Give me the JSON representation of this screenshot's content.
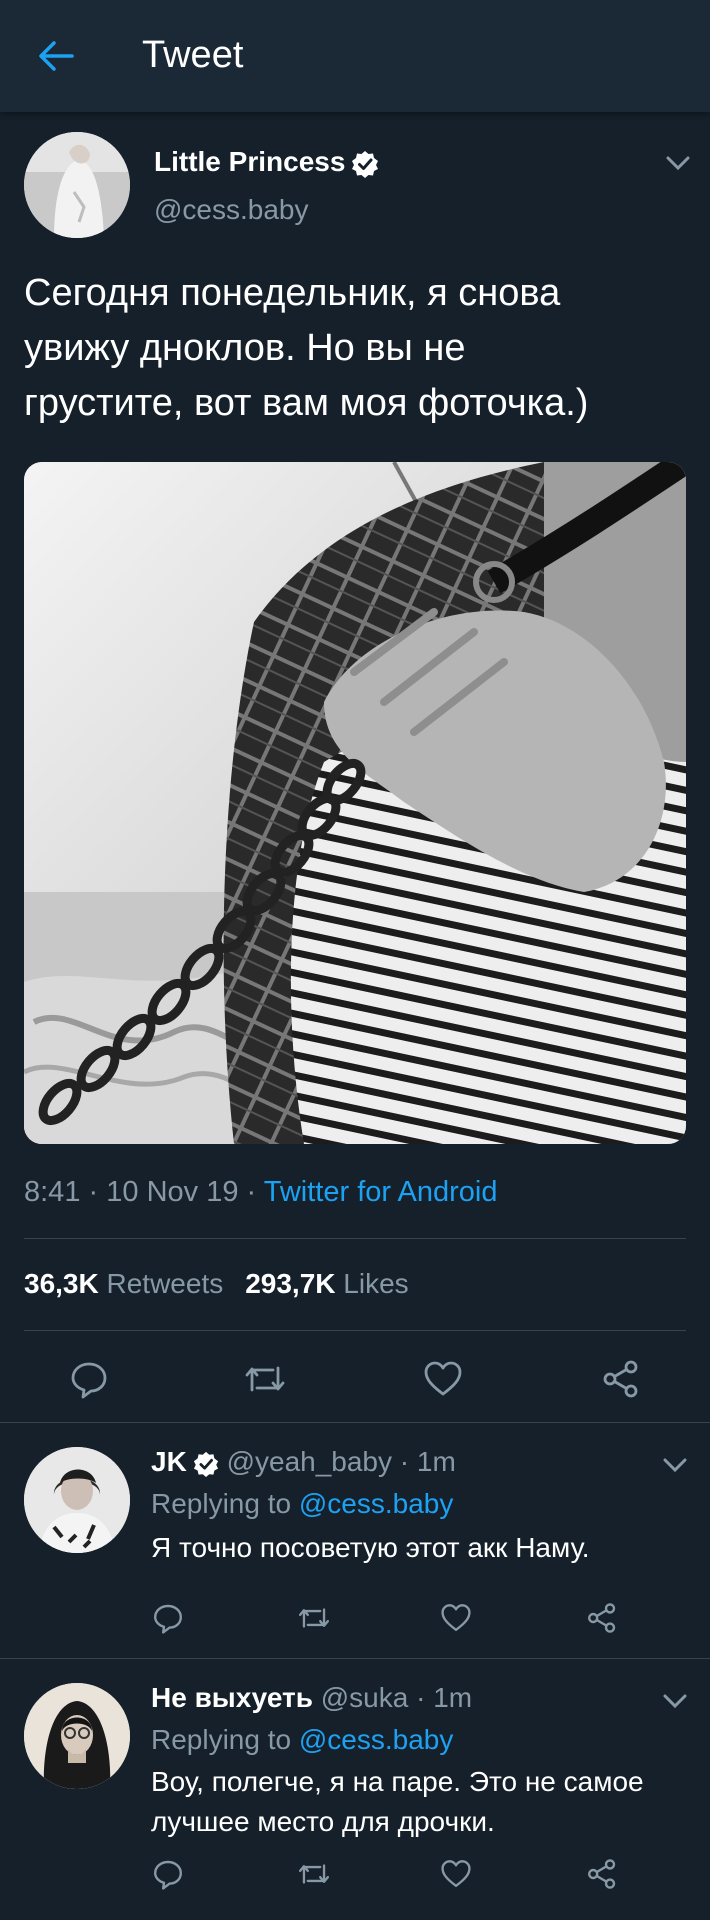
{
  "header": {
    "title": "Tweet",
    "back_icon": "arrow-left-icon",
    "accent": "#1da1f2"
  },
  "tweet": {
    "author_name": "Little Princess",
    "verified": true,
    "handle": "@cess.baby",
    "text_lines": [
      "Сегодня понедельник, я снова",
      "увижу дноклов. Но вы не",
      "грустите, вот вам моя фоточка.)"
    ],
    "time": "8:41",
    "date": "10 Nov 19",
    "source": "Twitter for Android",
    "sep": "·",
    "retweets_count": "36,3K",
    "retweets_label": "Retweets",
    "likes_count": "293,7K",
    "likes_label": "Likes"
  },
  "actions": {
    "reply_icon": "comment-icon",
    "retweet_icon": "retweet-icon",
    "like_icon": "heart-icon",
    "share_icon": "share-icon"
  },
  "replies": [
    {
      "name": "JK",
      "verified": true,
      "handle": "@yeah_baby",
      "time": "1m",
      "replying_to_label": "Replying to",
      "replying_to_handle": "@cess.baby",
      "text_lines": [
        "Я точно посоветую этот акк Наму."
      ]
    },
    {
      "name": "Не выхуеть",
      "verified": false,
      "handle": "@suka",
      "time": "1m",
      "replying_to_label": "Replying to",
      "replying_to_handle": "@cess.baby",
      "text_lines": [
        "Воу, полегче, я на паре. Это не самое",
        "лучшее место для дрочки."
      ]
    }
  ],
  "colors": {
    "background": "#15202b",
    "header": "#1b2836",
    "secondary_text": "#8899a6",
    "divider": "#38444d",
    "link": "#1da1f2"
  }
}
